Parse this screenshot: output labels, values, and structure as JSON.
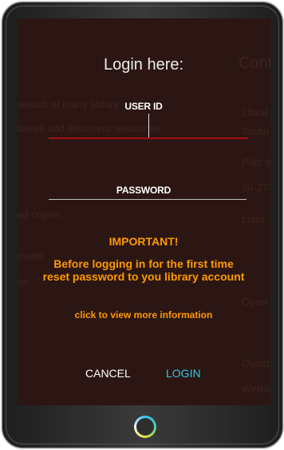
{
  "login": {
    "title": "Login here:",
    "user_id_label": "USER ID",
    "user_id_value": "",
    "password_label": "PASSWORD",
    "password_value": ""
  },
  "notice": {
    "heading": "IMPORTANT!",
    "line1": "Before logging in for the first time",
    "line2": "reset password to you library account",
    "more_info": "click to view more information"
  },
  "actions": {
    "cancel": "CANCEL",
    "login": "LOGIN"
  },
  "background_text": {
    "line1": "search of many library",
    "line2": "bases and electronic resources.",
    "line3": "ed copies.",
    "line4": "ments",
    "line5": "ns",
    "right1": "Cont",
    "right2": "Librar",
    "right3": "Techn",
    "right4": "Plac d",
    "right5": "90-277",
    "right6": "build",
    "right7": "Open",
    "right8": "Quest",
    "right9": "Websi"
  },
  "colors": {
    "accent": "#ff9900",
    "login": "#32c8e0",
    "active_field": "#a30f12",
    "screen": "#2b1613"
  },
  "icons": {
    "home": "home-ring-icon"
  }
}
